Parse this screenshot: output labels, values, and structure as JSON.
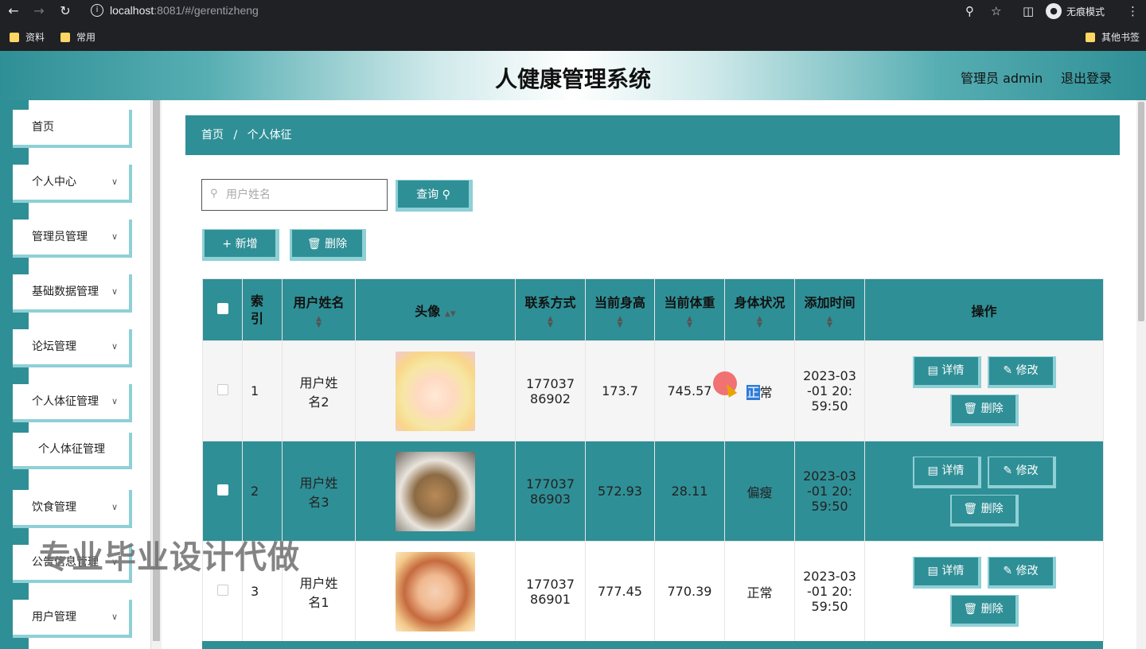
{
  "browser": {
    "url_host": "localhost",
    "url_rest": ":8081/#/gerentizheng",
    "incognito_label": "无痕模式",
    "bookmarks": [
      "资料",
      "常用"
    ],
    "other_bookmarks": "其他书签"
  },
  "header": {
    "title": "人健康管理系统",
    "admin_label": "管理员 admin",
    "logout": "退出登录"
  },
  "sidebar": {
    "items": [
      {
        "label": "首页",
        "chevron": false
      },
      {
        "label": "个人中心",
        "chevron": true
      },
      {
        "label": "管理员管理",
        "chevron": true
      },
      {
        "label": "基础数据管理",
        "chevron": true
      },
      {
        "label": "论坛管理",
        "chevron": true
      },
      {
        "label": "个人体征管理",
        "chevron": true
      },
      {
        "label": "饮食管理",
        "chevron": true
      },
      {
        "label": "公告信息管理",
        "chevron": true
      },
      {
        "label": "用户管理",
        "chevron": true
      }
    ],
    "submenu_item": "个人体征管理"
  },
  "breadcrumb": {
    "home": "首页",
    "sep": "/",
    "current": "个人体征"
  },
  "search": {
    "placeholder": "用户姓名",
    "value": "",
    "query_button": "查询"
  },
  "toolbar": {
    "add_button": "新增",
    "delete_button": "删除"
  },
  "table": {
    "columns": [
      "索引",
      "用户姓名",
      "头像",
      "联系方式",
      "当前身高",
      "当前体重",
      "身体状况",
      "添加时间",
      "操作"
    ],
    "rows": [
      {
        "index": "1",
        "name": "用户姓名2",
        "phone": "17703786902",
        "height": "173.7",
        "weight": "745.57",
        "status": "正常",
        "time": "2023-03-01 20:59:50"
      },
      {
        "index": "2",
        "name": "用户姓名3",
        "phone": "17703786903",
        "height": "572.93",
        "weight": "28.11",
        "status": "偏瘦",
        "time": "2023-03-01 20:59:50"
      },
      {
        "index": "3",
        "name": "用户姓名1",
        "phone": "17703786901",
        "height": "777.45",
        "weight": "770.39",
        "status": "正常",
        "time": "2023-03-01 20:59:50"
      }
    ],
    "actions": {
      "detail": "详情",
      "edit": "修改",
      "delete": "删除"
    }
  },
  "watermark": "专业毕业设计代做",
  "colors": {
    "primary": "#2f8f96",
    "accent_light": "#8fd0d6"
  }
}
